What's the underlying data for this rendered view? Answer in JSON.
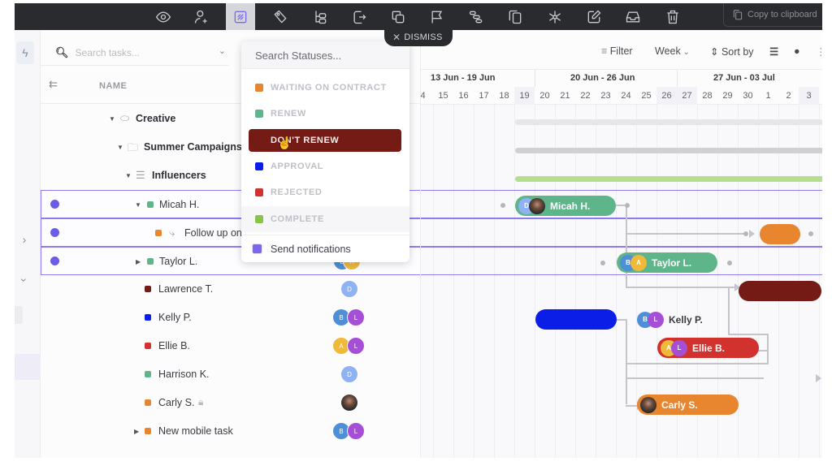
{
  "toolbar": {
    "icons": [
      {
        "name": "eye-icon",
        "active": false
      },
      {
        "name": "add-user-icon",
        "active": false
      },
      {
        "name": "status-icon",
        "active": true
      },
      {
        "name": "tag-icon",
        "active": false
      },
      {
        "name": "hierarchy-icon",
        "active": false
      },
      {
        "name": "move-icon",
        "active": false
      },
      {
        "name": "duplicate-icon",
        "active": false
      },
      {
        "name": "flag-icon",
        "active": false
      },
      {
        "name": "gantt-icon",
        "active": false
      },
      {
        "name": "copy-icon",
        "active": false
      },
      {
        "name": "dependency-icon",
        "active": false
      },
      {
        "name": "edit-icon",
        "active": false
      },
      {
        "name": "inbox-icon",
        "active": false
      },
      {
        "name": "trash-icon",
        "active": false
      }
    ],
    "copy_label": "Copy to clipboard",
    "dismiss_label": "DISMISS"
  },
  "list": {
    "search_placeholder": "Search tasks...",
    "name_header": "NAME",
    "rows": [
      {
        "label": "Creative",
        "type": "space",
        "bold": true
      },
      {
        "label": "Summer Campaigns",
        "type": "folder",
        "bold": true
      },
      {
        "label": "Influencers",
        "type": "list",
        "bold": true
      },
      {
        "label": "Micah H.",
        "status_color": "#5fb58a",
        "selected": true,
        "expanded": true
      },
      {
        "label": "Follow up on",
        "status_color": "#e8852f",
        "selected": true,
        "subtask": true
      },
      {
        "label": "Taylor L.",
        "status_color": "#5fb58a",
        "selected": true,
        "collapsed": true,
        "assignees": [
          "B",
          "A"
        ]
      },
      {
        "label": "Lawrence T.",
        "status_color": "#731b14",
        "assignees": [
          "D"
        ]
      },
      {
        "label": "Kelly P.",
        "status_color": "#0a1ee8",
        "assignees": [
          "B",
          "L"
        ]
      },
      {
        "label": "Ellie B.",
        "status_color": "#d1322d",
        "assignees": [
          "A",
          "L"
        ]
      },
      {
        "label": "Harrison K.",
        "status_color": "#5fb58a",
        "assignees": [
          "D"
        ]
      },
      {
        "label": "Carly S.",
        "status_color": "#e8852f",
        "locked": true,
        "assignees": [
          "photo"
        ]
      },
      {
        "label": "New mobile task",
        "status_color": "#e8852f",
        "collapsed": true,
        "assignees": [
          "B",
          "L"
        ]
      }
    ]
  },
  "status_dropdown": {
    "search_placeholder": "Search Statuses...",
    "statuses": [
      {
        "label": "WAITING ON CONTRACT",
        "color": "#e8852f"
      },
      {
        "label": "RENEW",
        "color": "#5fb58a"
      },
      {
        "label": "DON'T RENEW",
        "color": "#731b14",
        "hovered": true
      },
      {
        "label": "APPROVAL",
        "color": "#0a1ee8"
      },
      {
        "label": "REJECTED",
        "color": "#d1322d"
      },
      {
        "label": "COMPLETE",
        "color": "#8bc34a"
      }
    ],
    "notify_label": "Send notifications",
    "notify_checked": true
  },
  "gantt": {
    "filter_label": "Filter",
    "scale_label": "Week",
    "sort_label": "Sort by",
    "weeks": [
      "13 Jun - 19 Jun",
      "20 Jun - 26 Jun",
      "27 Jun - 03 Jul"
    ],
    "days": [
      "4",
      "15",
      "16",
      "17",
      "18",
      "19",
      "20",
      "21",
      "22",
      "23",
      "24",
      "25",
      "26",
      "27",
      "28",
      "29",
      "30",
      "1",
      "2",
      "3"
    ],
    "weekend_days": [
      "19",
      "26",
      "27",
      "3"
    ],
    "bars": [
      {
        "task": "Micah H.",
        "label": "Micah H.",
        "color": "#5fb58a",
        "avatars": [
          "D",
          "photo"
        ]
      },
      {
        "task": "Follow up on",
        "label": "",
        "color": "#e8852f"
      },
      {
        "task": "Taylor L.",
        "label": "Taylor L.",
        "color": "#5fb58a",
        "avatars": [
          "B",
          "A"
        ]
      },
      {
        "task": "Lawrence T.",
        "label": "",
        "color": "#731b14"
      },
      {
        "task": "Kelly P.",
        "label": "",
        "color": "#0a1ee8",
        "outside_label": "Kelly P.",
        "avatars": [
          "B",
          "L"
        ]
      },
      {
        "task": "Ellie B.",
        "label": "Ellie B.",
        "color": "#d1322d",
        "avatars": [
          "A",
          "L"
        ]
      },
      {
        "task": "Carly S.",
        "label": "Carly S.",
        "color": "#e8852f",
        "avatars": [
          "photo"
        ]
      }
    ],
    "summary_bars": [
      {
        "task": "Creative",
        "color": "#e6e6e6"
      },
      {
        "task": "Summer Campaigns",
        "color": "#d0d0d0"
      },
      {
        "task": "Influencers",
        "color": "#b5de8f"
      }
    ]
  },
  "avatar_colors": {
    "B": "#4f8fd8",
    "A": "#f0b93a",
    "L": "#a64fd6",
    "D": "#8fb2f5"
  }
}
